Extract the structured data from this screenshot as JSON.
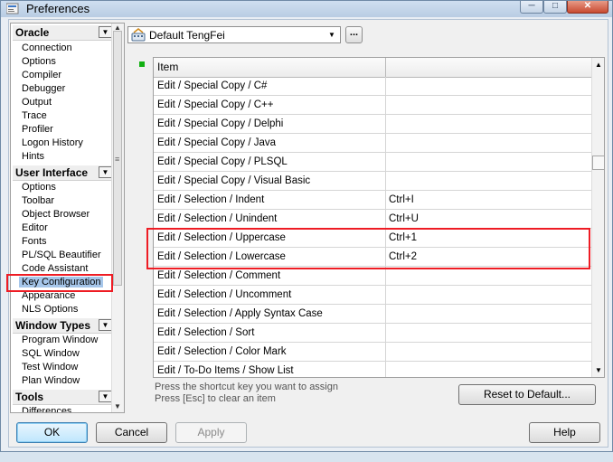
{
  "window": {
    "title": "Preferences",
    "minimize": "0",
    "maximize": "1",
    "close": "r"
  },
  "nav": {
    "groups": [
      {
        "label": "Oracle",
        "items": [
          "Connection",
          "Options",
          "Compiler",
          "Debugger",
          "Output",
          "Trace",
          "Profiler",
          "Logon History",
          "Hints"
        ]
      },
      {
        "label": "User Interface",
        "items": [
          "Options",
          "Toolbar",
          "Object Browser",
          "Editor",
          "Fonts",
          "PL/SQL Beautifier",
          "Code Assistant",
          "Key Configuration",
          "Appearance",
          "NLS Options"
        ]
      },
      {
        "label": "Window Types",
        "items": [
          "Program Window",
          "SQL Window",
          "Test Window",
          "Plan Window"
        ]
      },
      {
        "label": "Tools",
        "items": [
          "Differences"
        ]
      }
    ],
    "selected": "Key Configuration"
  },
  "profile": {
    "selected": "Default TengFei",
    "more": "..."
  },
  "table": {
    "headers": [
      "Item",
      ""
    ],
    "rows": [
      [
        "Edit / Special Copy / C#",
        ""
      ],
      [
        "Edit / Special Copy / C++",
        ""
      ],
      [
        "Edit / Special Copy / Delphi",
        ""
      ],
      [
        "Edit / Special Copy / Java",
        ""
      ],
      [
        "Edit / Special Copy / PLSQL",
        ""
      ],
      [
        "Edit / Special Copy / Visual Basic",
        ""
      ],
      [
        "Edit / Selection / Indent",
        "Ctrl+I"
      ],
      [
        "Edit / Selection / Unindent",
        "Ctrl+U"
      ],
      [
        "Edit / Selection / Uppercase",
        "Ctrl+1"
      ],
      [
        "Edit / Selection / Lowercase",
        "Ctrl+2"
      ],
      [
        "Edit / Selection / Comment",
        ""
      ],
      [
        "Edit / Selection / Uncomment",
        ""
      ],
      [
        "Edit / Selection / Apply Syntax Case",
        ""
      ],
      [
        "Edit / Selection / Sort",
        ""
      ],
      [
        "Edit / Selection / Color Mark",
        ""
      ],
      [
        "Edit / To-Do Items / Show List",
        ""
      ]
    ]
  },
  "hints": [
    "Press the shortcut key you want to assign",
    "Press [Esc] to clear an item"
  ],
  "buttons": {
    "reset": "Reset to Default...",
    "ok": "OK",
    "cancel": "Cancel",
    "apply": "Apply",
    "help": "Help"
  },
  "colors": {
    "highlight": "#ee1c24",
    "selection": "#a6c6ea"
  }
}
